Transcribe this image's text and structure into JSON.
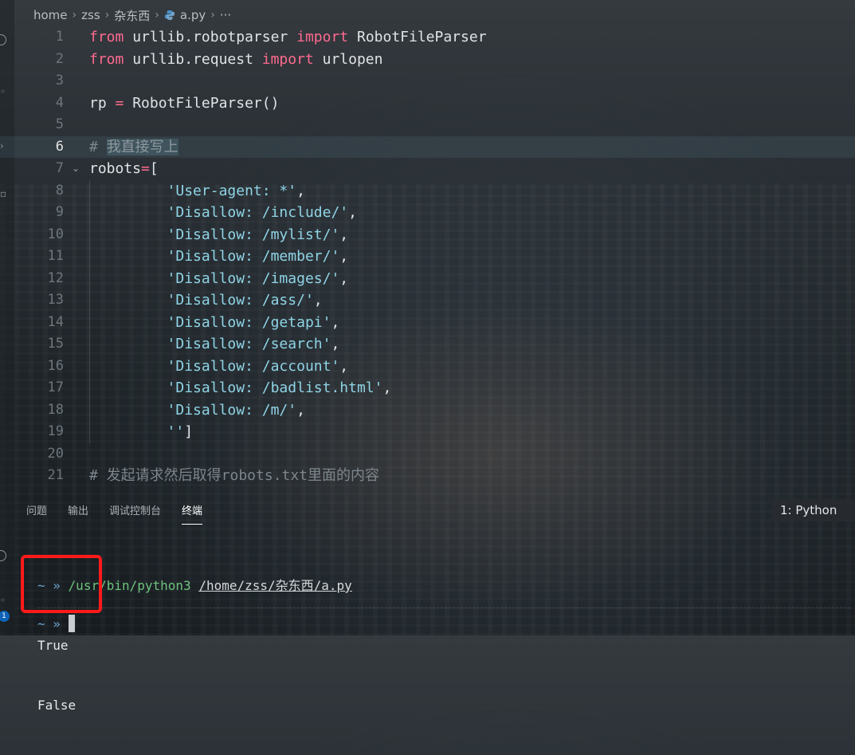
{
  "breadcrumb": {
    "items": [
      "home",
      "zss",
      "杂东西",
      "a.py",
      "···"
    ]
  },
  "editor": {
    "lines": [
      {
        "n": "1",
        "tokens": [
          [
            "kw",
            "from"
          ],
          [
            "id",
            " urllib.robotparser "
          ],
          [
            "kw",
            "import"
          ],
          [
            "id",
            " RobotFileParser"
          ]
        ]
      },
      {
        "n": "2",
        "tokens": [
          [
            "kw",
            "from"
          ],
          [
            "id",
            " urllib.request "
          ],
          [
            "kw",
            "import"
          ],
          [
            "id",
            " urlopen"
          ]
        ]
      },
      {
        "n": "3",
        "tokens": []
      },
      {
        "n": "4",
        "tokens": [
          [
            "id",
            "rp "
          ],
          [
            "kw",
            "="
          ],
          [
            "id",
            " RobotFileParser()"
          ]
        ]
      },
      {
        "n": "5",
        "tokens": []
      },
      {
        "n": "6",
        "active": true,
        "tokens": [
          [
            "cm",
            "# "
          ],
          [
            "cmhl",
            "我直接写上"
          ]
        ]
      },
      {
        "n": "7",
        "fold": true,
        "tokens": [
          [
            "id",
            "robots"
          ],
          [
            "kw",
            "="
          ],
          [
            "id",
            "["
          ]
        ]
      },
      {
        "n": "8",
        "tokens": [
          [
            "id",
            "         "
          ],
          [
            "str",
            "'User-agent: *'"
          ],
          [
            "id",
            ","
          ]
        ]
      },
      {
        "n": "9",
        "tokens": [
          [
            "id",
            "         "
          ],
          [
            "str",
            "'Disallow: /include/'"
          ],
          [
            "id",
            ","
          ]
        ]
      },
      {
        "n": "10",
        "tokens": [
          [
            "id",
            "         "
          ],
          [
            "str",
            "'Disallow: /mylist/'"
          ],
          [
            "id",
            ","
          ]
        ]
      },
      {
        "n": "11",
        "tokens": [
          [
            "id",
            "         "
          ],
          [
            "str",
            "'Disallow: /member/'"
          ],
          [
            "id",
            ","
          ]
        ]
      },
      {
        "n": "12",
        "tokens": [
          [
            "id",
            "         "
          ],
          [
            "str",
            "'Disallow: /images/'"
          ],
          [
            "id",
            ","
          ]
        ]
      },
      {
        "n": "13",
        "tokens": [
          [
            "id",
            "         "
          ],
          [
            "str",
            "'Disallow: /ass/'"
          ],
          [
            "id",
            ","
          ]
        ]
      },
      {
        "n": "14",
        "tokens": [
          [
            "id",
            "         "
          ],
          [
            "str",
            "'Disallow: /getapi'"
          ],
          [
            "id",
            ","
          ]
        ]
      },
      {
        "n": "15",
        "tokens": [
          [
            "id",
            "         "
          ],
          [
            "str",
            "'Disallow: /search'"
          ],
          [
            "id",
            ","
          ]
        ]
      },
      {
        "n": "16",
        "tokens": [
          [
            "id",
            "         "
          ],
          [
            "str",
            "'Disallow: /account'"
          ],
          [
            "id",
            ","
          ]
        ]
      },
      {
        "n": "17",
        "tokens": [
          [
            "id",
            "         "
          ],
          [
            "str",
            "'Disallow: /badlist.html'"
          ],
          [
            "id",
            ","
          ]
        ]
      },
      {
        "n": "18",
        "tokens": [
          [
            "id",
            "         "
          ],
          [
            "str",
            "'Disallow: /m/'"
          ],
          [
            "id",
            ","
          ]
        ]
      },
      {
        "n": "19",
        "tokens": [
          [
            "id",
            "         "
          ],
          [
            "str",
            "''"
          ],
          [
            "id",
            "]"
          ]
        ]
      },
      {
        "n": "20",
        "tokens": []
      },
      {
        "n": "21",
        "tokens": [
          [
            "cm",
            "# 发起请求然后取得robots.txt里面的内容"
          ]
        ]
      }
    ]
  },
  "panel": {
    "tabs": [
      {
        "label": "问题",
        "active": false
      },
      {
        "label": "输出",
        "active": false
      },
      {
        "label": "调试控制台",
        "active": false
      },
      {
        "label": "终端",
        "active": true
      }
    ],
    "terminal_select": "1: Python"
  },
  "terminal": {
    "prompt": "~ »",
    "interpreter": "/usr/bin/python3",
    "script": "/home/zss/杂东西/a.py",
    "output": [
      "True",
      "False"
    ],
    "second_prompt": "~ »"
  },
  "activity": {
    "badge_count": "1"
  },
  "colors": {
    "keyword": "#ff6a8f",
    "string": "#8fd4e6",
    "comment": "#7d868c",
    "highlight_box": "#ff1a1a",
    "terminal_green": "#6fc37d"
  }
}
